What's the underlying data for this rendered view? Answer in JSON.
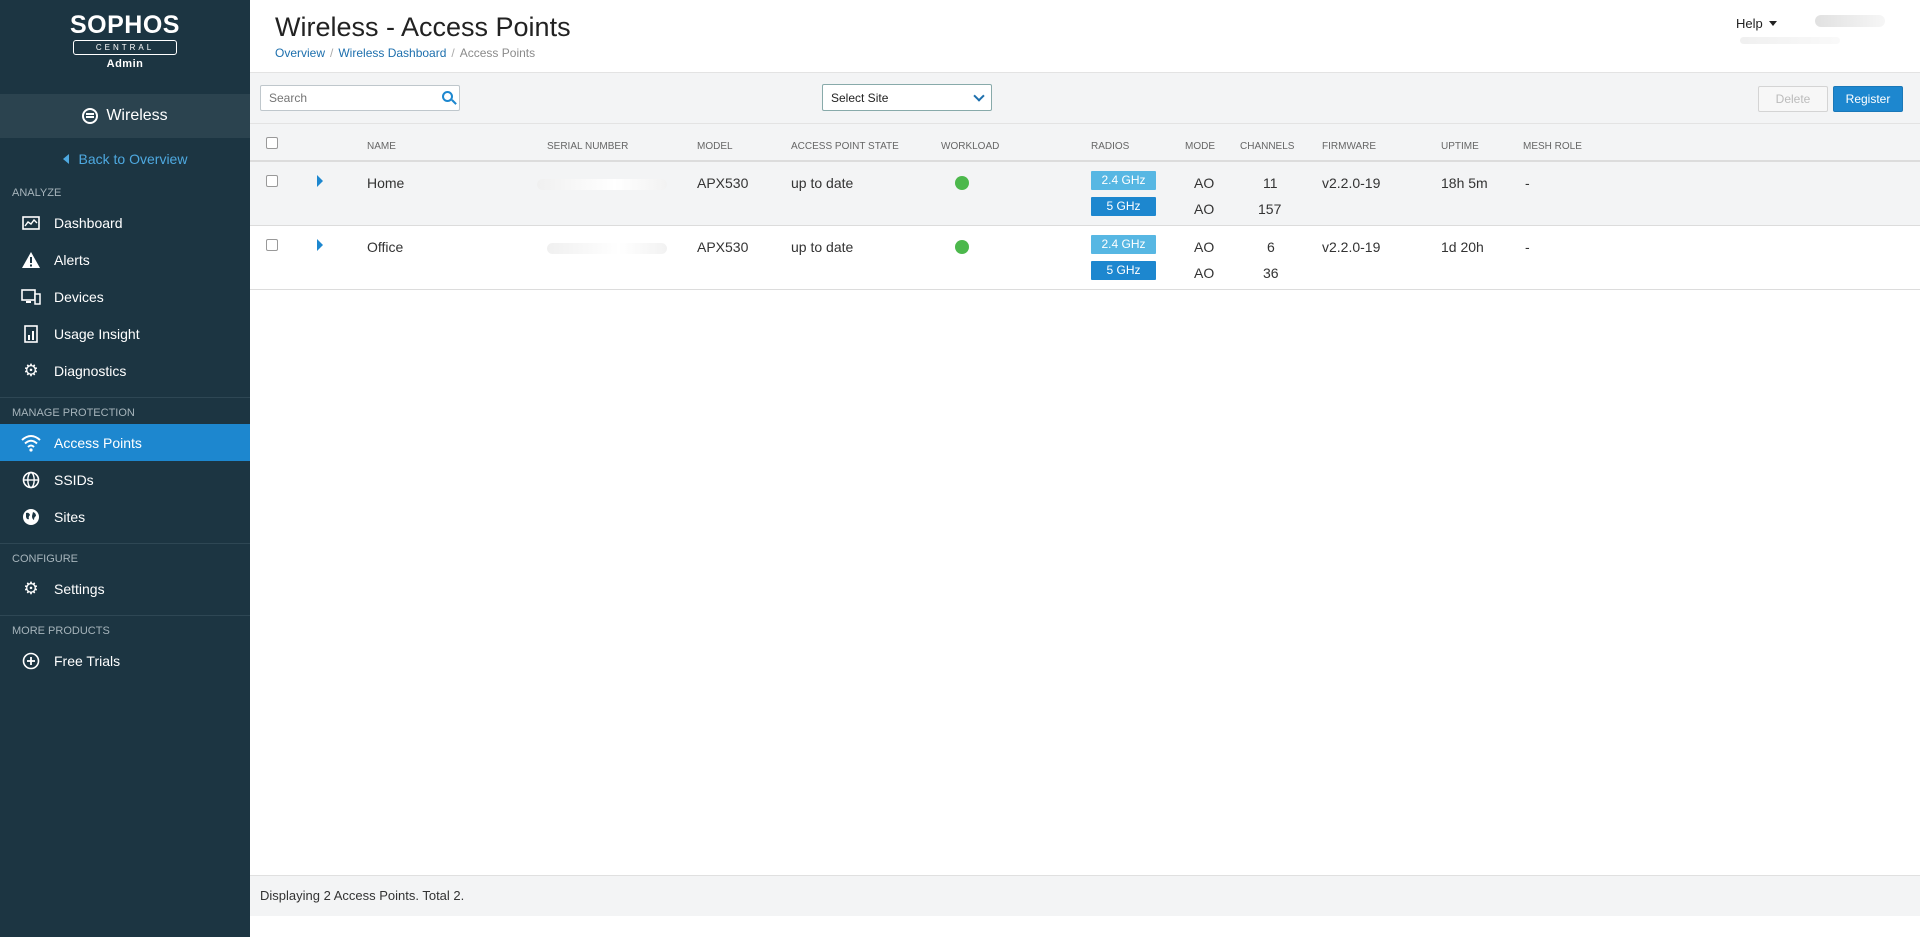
{
  "sidebar": {
    "brand": "SOPHOS",
    "brand_sub": "CENTRAL",
    "brand_role": "Admin",
    "product": "Wireless",
    "back_label": "Back to Overview",
    "sections": {
      "analyze": "ANALYZE",
      "manage": "MANAGE PROTECTION",
      "configure": "CONFIGURE",
      "more": "MORE PRODUCTS"
    },
    "items": {
      "dashboard": "Dashboard",
      "alerts": "Alerts",
      "devices": "Devices",
      "usage": "Usage Insight",
      "diagnostics": "Diagnostics",
      "access_points": "Access Points",
      "ssids": "SSIDs",
      "sites": "Sites",
      "settings": "Settings",
      "free_trials": "Free Trials"
    },
    "active_item": "Access Points"
  },
  "header": {
    "title": "Wireless - Access Points",
    "breadcrumb": [
      "Overview",
      "Wireless Dashboard",
      "Access Points"
    ],
    "help_label": "Help"
  },
  "toolbar": {
    "search_placeholder": "Search",
    "site_select": "Select Site",
    "delete_label": "Delete",
    "register_label": "Register"
  },
  "table": {
    "columns": [
      "NAME",
      "SERIAL NUMBER",
      "MODEL",
      "ACCESS POINT STATE",
      "WORKLOAD",
      "RADIOS",
      "MODE",
      "CHANNELS",
      "FIRMWARE",
      "UPTIME",
      "MESH ROLE"
    ],
    "rows": [
      {
        "name": "Home",
        "model": "APX530",
        "state": "up to date",
        "radios": [
          "2.4 GHz",
          "5 GHz"
        ],
        "modes": [
          "AO",
          "AO"
        ],
        "channels": [
          "11",
          "157"
        ],
        "firmware": "v2.2.0-19",
        "uptime": "18h 5m",
        "mesh_role": "-"
      },
      {
        "name": "Office",
        "model": "APX530",
        "state": "up to date",
        "radios": [
          "2.4 GHz",
          "5 GHz"
        ],
        "modes": [
          "AO",
          "AO"
        ],
        "channels": [
          "6",
          "36"
        ],
        "firmware": "v2.2.0-19",
        "uptime": "1d 20h",
        "mesh_role": "-"
      }
    ]
  },
  "footer": {
    "status": "Displaying 2 Access Points. Total 2."
  },
  "colors": {
    "sidebar_bg": "#1c3542",
    "accent": "#1d87cf",
    "radio_24": "#57b7e3",
    "workload_ok": "#4cb84c"
  }
}
